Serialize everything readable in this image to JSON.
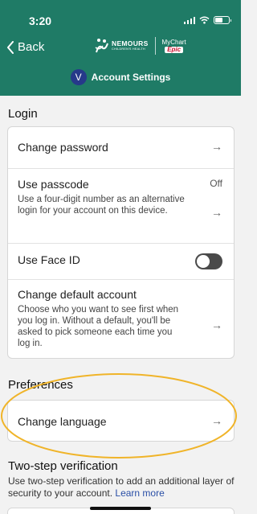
{
  "status_bar": {
    "time": "3:20"
  },
  "nav": {
    "back_label": "Back",
    "brand_name": "NEMOURS",
    "brand_sub": "CHILDREN'S HEALTH",
    "mychart_label": "MyChart",
    "epic_label": "Epic"
  },
  "account": {
    "avatar_initial": "V",
    "title": "Account Settings"
  },
  "login": {
    "heading": "Login",
    "change_password": "Change password",
    "use_passcode": {
      "title": "Use passcode",
      "value": "Off",
      "description": "Use a four-digit number as an alternative login for your account on this device."
    },
    "face_id": {
      "title": "Use Face ID",
      "enabled": false
    },
    "default_account": {
      "title": "Change default account",
      "description": "Choose who you want to see first when you log in. Without a default, you'll be asked to pick someone each time you log in."
    }
  },
  "preferences": {
    "heading": "Preferences",
    "change_language": "Change language"
  },
  "two_step": {
    "heading": "Two-step verification",
    "description": "Use two-step verification to add an additional layer of security to your account.",
    "learn_more": "Learn more"
  },
  "arrow_glyph": "→",
  "colors": {
    "header_bg": "#1f7b66",
    "annotation": "#f0b429",
    "link": "#2a4fa6"
  }
}
